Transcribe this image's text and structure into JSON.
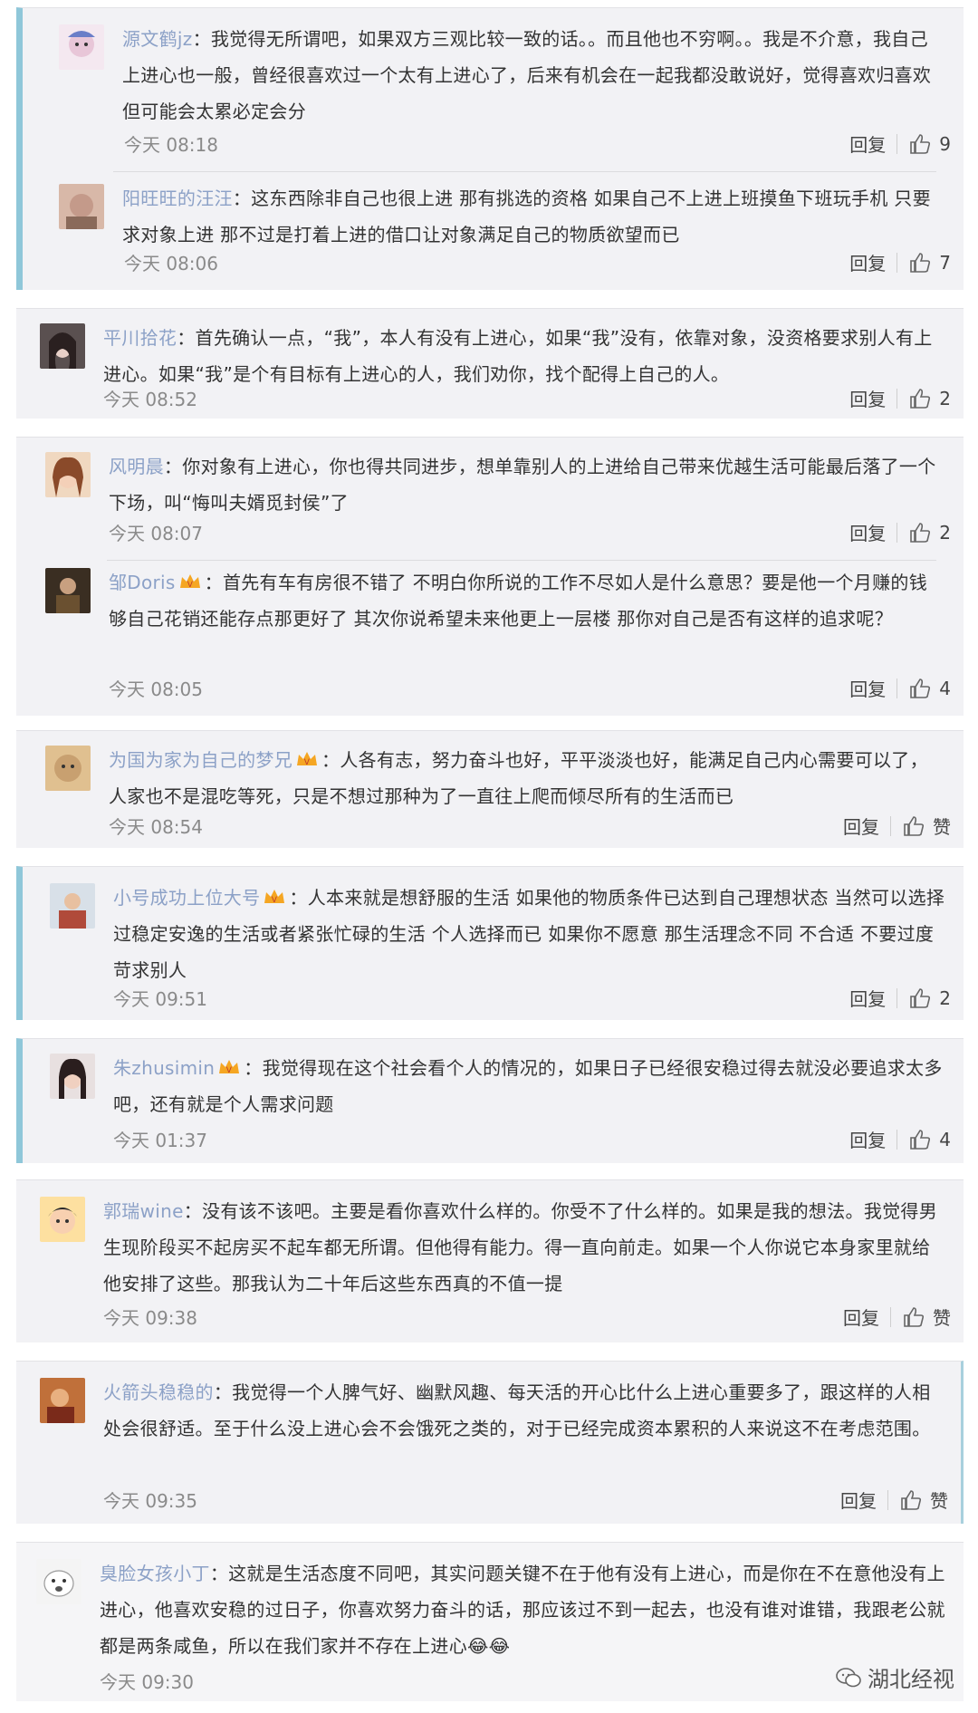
{
  "labels": {
    "reply": "回复"
  },
  "cards": [
    {
      "comments": [
        {
          "username": "源文鹤jz",
          "text": "我觉得无所谓吧，如果双方三观比较一致的话。。而且他也不穷啊。。我是不介意，我自己上进心也一般，曾经很喜欢过一个太有上进心了，后来有机会在一起我都没敢说好，觉得喜欢归喜欢但可能会太累必定会分",
          "time": "今天 08:18",
          "likes": "9",
          "avatar_color": "#e8c6d8"
        },
        {
          "username": "阳旺旺的汪汪",
          "text": "这东西除非自己也很上进 那有挑选的资格 如果自己不上进上班摸鱼下班玩手机 只要求对象上进 那不过是打着上进的借口让对象满足自己的物质欲望而已",
          "time": "今天 08:06",
          "likes": "7",
          "avatar_color": "#c49a8a"
        }
      ]
    },
    {
      "comments": [
        {
          "username": "平川拾花",
          "text": "首先确认一点，“我”，本人有没有上进心，如果“我”没有，依靠对象，没资格要求别人有上进心。如果“我”是个有目标有上进心的人，我们劝你，找个配得上自己的人。",
          "time": "今天 08:52",
          "likes": "2",
          "avatar_color": "#7a6e70"
        }
      ]
    },
    {
      "comments": [
        {
          "username": "风明晨",
          "text": "你对象有上进心，你也得共同进步，想单靠别人的上进给自己带来优越生活可能最后落了一个下场，叫“悔叫夫婿觅封侯”了",
          "time": "今天 08:07",
          "likes": "2",
          "avatar_color": "#d8a89a"
        },
        {
          "username": "邹Doris",
          "text": "首先有车有房很不错了 不明白你所说的工作不尽如人是什么意思？要是他一个月赚的钱够自己花销还能存点那更好了 其次你说希望未来他更上一层楼 那你对自己是否有这样的追求呢？",
          "time": "今天 08:05",
          "likes": "4",
          "avatar_color": "#4a3a2a"
        }
      ]
    },
    {
      "comments": [
        {
          "username": "为国为家为自己的梦兄",
          "text": "人各有志，努力奋斗也好，平平淡淡也好，能满足自己内心需要可以了，人家也不是混吃等死，只是不想过那种为了一直往上爬而倾尽所有的生活而已",
          "time": "今天 08:54",
          "likes": "赞",
          "avatar_color": "#c8a070"
        }
      ]
    },
    {
      "comments": [
        {
          "username": "小号成功上位大号",
          "text": "人本来就是想舒服的生活 如果他的物质条件已达到自己理想状态 当然可以选择过稳定安逸的生活或者紧张忙碌的生活 个人选择而已 如果你不愿意 那生活理念不同 不合适 不要过度苛求别人",
          "time": "今天 09:51",
          "likes": "2",
          "avatar_color": "#b04a3a"
        }
      ]
    },
    {
      "comments": [
        {
          "username": "朱zhusimin",
          "text": "我觉得现在这个社会看个人的情况的，如果日子已经很安稳过得去就没必要追求太多吧，还有就是个人需求问题",
          "time": "今天 01:37",
          "likes": "4",
          "avatar_color": "#5a4a48"
        }
      ]
    },
    {
      "comments": [
        {
          "username": "郭瑞wine",
          "text": "没有该不该吧。主要是看你喜欢什么样的。你受不了什么样的。如果是我的想法。我觉得男生现阶段买不起房买不起车都无所谓。但他得有能力。得一直向前走。如果一个人你说它本身家里就给他安排了这些。那我认为二十年后这些东西真的不值一提",
          "time": "今天 09:38",
          "likes": "赞",
          "avatar_color": "#f0b040"
        }
      ]
    },
    {
      "comments": [
        {
          "username": "火箭头稳稳的",
          "text": "我觉得一个人脾气好、幽默风趣、每天活的开心比什么上进心重要多了，跟这样的人相处会很舒适。至于什么没上进心会不会饿死之类的，对于已经完成资本累积的人来说这不在考虑范围。",
          "time": "今天 09:35",
          "likes": "赞",
          "avatar_color": "#a0503a"
        }
      ]
    },
    {
      "comments": [
        {
          "username": "臭脸女孩小丁",
          "text": "这就是生活态度不同吧，其实问题关键不在于他有没有上进心，而是你在不在意他没有上进心，他喜欢安稳的过日子，你喜欢努力奋斗的话，那应该过不到一起去，也没有谁对谁错，我跟老公就都是两条咸鱼，所以在我们家并不存在上进心😂😂",
          "time": "今天 09:30",
          "likes": "",
          "avatar_color": "#e8e8e8"
        }
      ]
    }
  ],
  "watermark": {
    "text": "湖北经视",
    "icon": "wechat-icon"
  },
  "colors": {
    "card_bg": "#f2f2f5",
    "username": "#6a86b8",
    "accent": "#8fc7d9"
  }
}
